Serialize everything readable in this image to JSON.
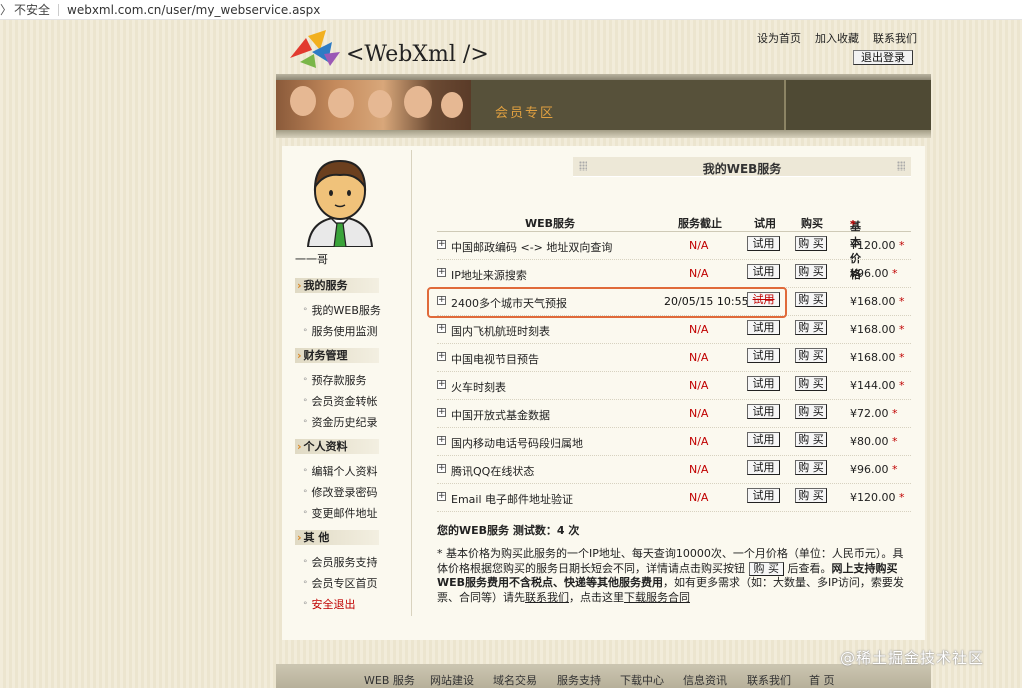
{
  "browser": {
    "security_label": "不安全",
    "url": "webxml.com.cn/user/my_webservice.aspx"
  },
  "header": {
    "logo_text": "<WebXml />",
    "links": [
      "设为首页",
      "加入收藏",
      "联系我们"
    ],
    "logout_label": "退出登录"
  },
  "banner": {
    "title": "会员专区"
  },
  "sidebar": {
    "username": "一一哥",
    "sections": [
      {
        "title": "我的服务",
        "items": [
          "我的WEB服务",
          "服务使用监测"
        ]
      },
      {
        "title": "财务管理",
        "items": [
          "预存款服务",
          "会员资金转帐",
          "资金历史纪录"
        ]
      },
      {
        "title": "个人资料",
        "items": [
          "编辑个人资料",
          "修改登录密码",
          "变更邮件地址"
        ]
      },
      {
        "title": "其  他",
        "items": [
          "会员服务支持",
          "会员专区首页",
          "安全退出"
        ]
      }
    ]
  },
  "main": {
    "section_title": "我的WEB服务",
    "columns": [
      "WEB服务",
      "服务截止",
      "试用",
      "购买",
      "基本价格"
    ],
    "required_mark": "*",
    "try_label": "试用",
    "buy_label": "购 买",
    "rows": [
      {
        "name": "中国邮政编码 <-> 地址双向查询",
        "expiry": "N/A",
        "price": "¥120.00"
      },
      {
        "name": "IP地址来源搜索",
        "expiry": "N/A",
        "price": "¥96.00"
      },
      {
        "name": "2400多个城市天气预报",
        "expiry": "20/05/15 10:55",
        "price": "¥168.00"
      },
      {
        "name": "国内飞机航班时刻表",
        "expiry": "N/A",
        "price": "¥168.00"
      },
      {
        "name": "中国电视节目预告",
        "expiry": "N/A",
        "price": "¥168.00"
      },
      {
        "name": "火车时刻表",
        "expiry": "N/A",
        "price": "¥144.00"
      },
      {
        "name": "中国开放式基金数据",
        "expiry": "N/A",
        "price": "¥72.00"
      },
      {
        "name": "国内移动电话号码段归属地",
        "expiry": "N/A",
        "price": "¥80.00"
      },
      {
        "name": "腾讯QQ在线状态",
        "expiry": "N/A",
        "price": "¥96.00"
      },
      {
        "name": "Email 电子邮件地址验证",
        "expiry": "N/A",
        "price": "¥120.00"
      }
    ],
    "test_count_label": "您的WEB服务 测试数：",
    "test_count_value": "4 次",
    "note": {
      "p1": "* 基本价格为购买此服务的一个IP地址、每天查询10000次、一个月价格（单位：人民币元）。具体价格根据您购买的服务日期长短会不同，详情请点击购买按钮",
      "btn": "购 买",
      "p2": "后查看。",
      "p3_bold": "网上支持购买WEB服务费用不含税点、快递等其他服务费用",
      "p4": "，如有更多需求（如：大数量、多IP访问，索要发票、合同等）请先",
      "link1": "联系我们",
      "p5": "，点击这里",
      "link2": "下载服务合同"
    }
  },
  "footer": {
    "links": [
      "WEB 服务",
      "网站建设",
      "域名交易",
      "服务支持",
      "下载中心",
      "信息资讯",
      "联系我们",
      "首  页"
    ]
  },
  "watermark": "@稀土掘金技术社区",
  "colors": {
    "accent_red": "#c00000",
    "banner_brown": "#57513a",
    "banner_title": "#e0a040",
    "highlight": "#e06a3a"
  }
}
